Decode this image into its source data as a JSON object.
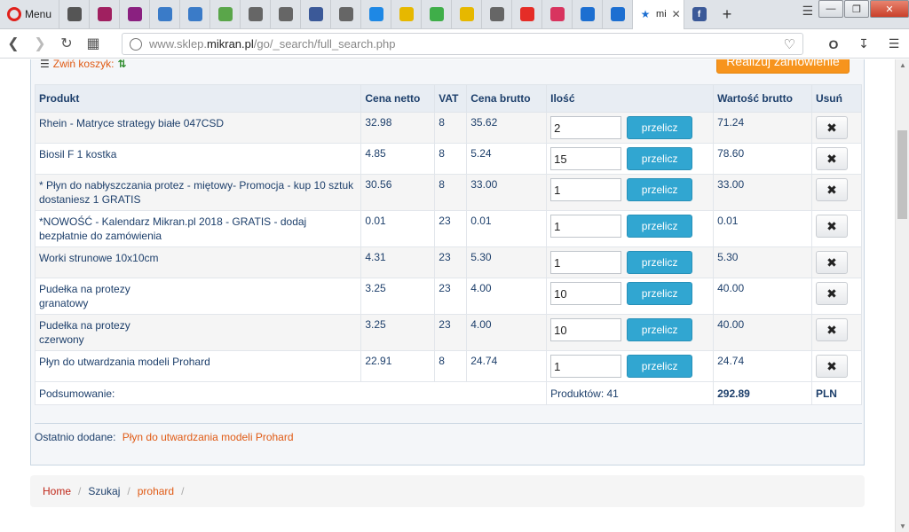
{
  "browser": {
    "menu_label": "Menu",
    "active_tab_title": "mi",
    "tab_favicons": [
      {
        "icon": "shield-tab-icon",
        "color": "#555"
      },
      {
        "icon": "x-tab-icon",
        "color": "#a02060"
      },
      {
        "icon": "x-tab-icon",
        "color": "#8a2080"
      },
      {
        "icon": "wave-tab-icon",
        "color": "#3a7bc8"
      },
      {
        "icon": "wave-tab-icon",
        "color": "#3a7bc8"
      },
      {
        "icon": "doc-green-tab-icon",
        "color": "#5aa64a"
      },
      {
        "icon": "doc-tab-icon",
        "color": "#666"
      },
      {
        "icon": "doc-tab-icon",
        "color": "#666"
      },
      {
        "icon": "facebook-tab-icon",
        "color": "#3b5998"
      },
      {
        "icon": "doc-tab-icon",
        "color": "#666"
      },
      {
        "icon": "c-tab-icon",
        "color": "#1e88e5"
      },
      {
        "icon": "cl-tab-icon",
        "color": "#e6b800"
      },
      {
        "icon": "green-circle-tab-icon",
        "color": "#3fae49"
      },
      {
        "icon": "cl-tab-icon",
        "color": "#e6b800"
      },
      {
        "icon": "doc-tab-icon",
        "color": "#666"
      },
      {
        "icon": "youtube-tab-icon",
        "color": "#e52d27"
      },
      {
        "icon": "u-tab-icon",
        "color": "#d8345f"
      },
      {
        "icon": "runner-tab-icon",
        "color": "#1d6fd1"
      },
      {
        "icon": "runner-tab-icon",
        "color": "#1d6fd1"
      }
    ],
    "after_active_favicon": {
      "icon": "facebook-tab-icon",
      "color": "#3b5998"
    },
    "new_tab_label": "+",
    "url_prefix": "www.sklep.",
    "url_host": "mikran.pl",
    "url_path": "/go/_search/full_search.php"
  },
  "cart": {
    "collapse_label": "Zwiń koszyk:",
    "order_button": "Realizuj zamówienie",
    "headers": [
      "Produkt",
      "Cena netto",
      "VAT",
      "Cena brutto",
      "Ilość",
      "Wartość brutto",
      "Usuń"
    ],
    "recalc_label": "przelicz",
    "rows": [
      {
        "name": "Rhein - Matryce strategy białe 047CSD",
        "variant": "",
        "net": "32.98",
        "vat": "8",
        "gross": "35.62",
        "qty": "2",
        "value": "71.24"
      },
      {
        "name": "Biosil F 1 kostka",
        "variant": "",
        "net": "4.85",
        "vat": "8",
        "gross": "5.24",
        "qty": "15",
        "value": "78.60"
      },
      {
        "name": "* Płyn do nabłyszczania protez - miętowy- Promocja - kup 10 sztuk dostaniesz 1 GRATIS",
        "variant": "",
        "net": "30.56",
        "vat": "8",
        "gross": "33.00",
        "qty": "1",
        "value": "33.00"
      },
      {
        "name": "*NOWOŚĆ - Kalendarz Mikran.pl 2018 - GRATIS - dodaj bezpłatnie do zamówienia",
        "variant": "",
        "net": "0.01",
        "vat": "23",
        "gross": "0.01",
        "qty": "1",
        "value": "0.01"
      },
      {
        "name": "Worki strunowe 10x10cm",
        "variant": "",
        "net": "4.31",
        "vat": "23",
        "gross": "5.30",
        "qty": "1",
        "value": "5.30"
      },
      {
        "name": "Pudełka na protezy",
        "variant": "granatowy",
        "net": "3.25",
        "vat": "23",
        "gross": "4.00",
        "qty": "10",
        "value": "40.00"
      },
      {
        "name": "Pudełka na protezy",
        "variant": "czerwony",
        "net": "3.25",
        "vat": "23",
        "gross": "4.00",
        "qty": "10",
        "value": "40.00"
      },
      {
        "name": "Płyn do utwardzania modeli Prohard",
        "variant": "",
        "net": "22.91",
        "vat": "8",
        "gross": "24.74",
        "qty": "1",
        "value": "24.74"
      }
    ],
    "summary_label": "Podsumowanie:",
    "products_count_label": "Produktów: 41",
    "total": "292.89",
    "currency": "PLN",
    "last_added_label": "Ostatnio dodane:",
    "last_added_product": "Płyn do utwardzania modeli Prohard"
  },
  "breadcrumb": {
    "items": [
      "Home",
      "Szukaj",
      "prohard"
    ],
    "separator": "/"
  }
}
